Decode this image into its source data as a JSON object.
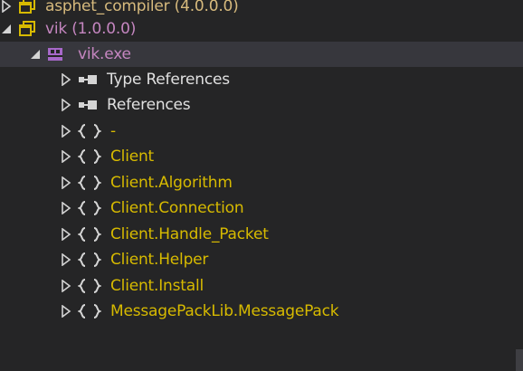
{
  "tree": {
    "items": [
      {
        "label": "asphet_compiler (4.0.0.0)",
        "icon": "assembly-icon",
        "state": "collapsed",
        "color": "#d7ba7d"
      },
      {
        "label": "vik (1.0.0.0)",
        "icon": "assembly-icon",
        "state": "expanded",
        "color": "#c586c0"
      },
      {
        "label": "vik.exe",
        "icon": "module-icon",
        "state": "expanded",
        "color": "#c586c0",
        "selected": true
      },
      {
        "label": "Type References",
        "icon": "references-icon",
        "state": "collapsed",
        "color": "#e0e0e0"
      },
      {
        "label": "References",
        "icon": "references-icon",
        "state": "collapsed",
        "color": "#e0e0e0"
      },
      {
        "label": "-",
        "icon": "namespace-icon",
        "state": "collapsed",
        "color": "#d7ba00"
      },
      {
        "label": "Client",
        "icon": "namespace-icon",
        "state": "collapsed",
        "color": "#d7ba00"
      },
      {
        "label": "Client.Algorithm",
        "icon": "namespace-icon",
        "state": "collapsed",
        "color": "#d7ba00"
      },
      {
        "label": "Client.Connection",
        "icon": "namespace-icon",
        "state": "collapsed",
        "color": "#d7ba00"
      },
      {
        "label": "Client.Handle_Packet",
        "icon": "namespace-icon",
        "state": "collapsed",
        "color": "#d7ba00"
      },
      {
        "label": "Client.Helper",
        "icon": "namespace-icon",
        "state": "collapsed",
        "color": "#d7ba00"
      },
      {
        "label": "Client.Install",
        "icon": "namespace-icon",
        "state": "collapsed",
        "color": "#d7ba00"
      },
      {
        "label": "MessagePackLib.MessagePack",
        "icon": "namespace-icon",
        "state": "collapsed",
        "color": "#d7ba00"
      }
    ]
  }
}
